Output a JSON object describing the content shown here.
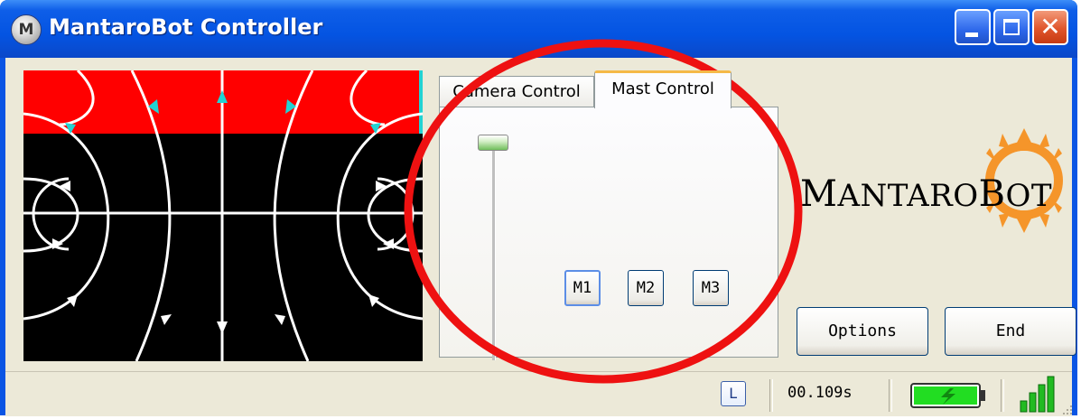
{
  "window": {
    "title": "MantaroBot Controller",
    "icon_letter": "M",
    "controls": [
      "minimize-icon",
      "maximize-icon",
      "close-icon"
    ]
  },
  "tabs": [
    {
      "label": "Camera Control",
      "active": false
    },
    {
      "label": "Mast Control",
      "active": true
    }
  ],
  "mast": {
    "slider_level": 1.0,
    "buttons": [
      "M1",
      "M2",
      "M3"
    ],
    "focused_button": "M1"
  },
  "logo": {
    "text_first": "M",
    "text_rest": "ANTARO",
    "text_b": "B",
    "text_end": "OT",
    "sun_color": "#f5952a"
  },
  "actions": {
    "options_label": "Options",
    "end_label": "End"
  },
  "status": {
    "mode_badge": "L",
    "timer": "00.109s",
    "battery_level": 1.0,
    "battery_icon": "battery-charging-icon",
    "signal_bars": 4
  },
  "colors": {
    "accent_red": "#ff0000",
    "arrow_cyan": "#22d3d3",
    "battery_green": "#22dd22",
    "annotation_red": "#ee1111"
  }
}
